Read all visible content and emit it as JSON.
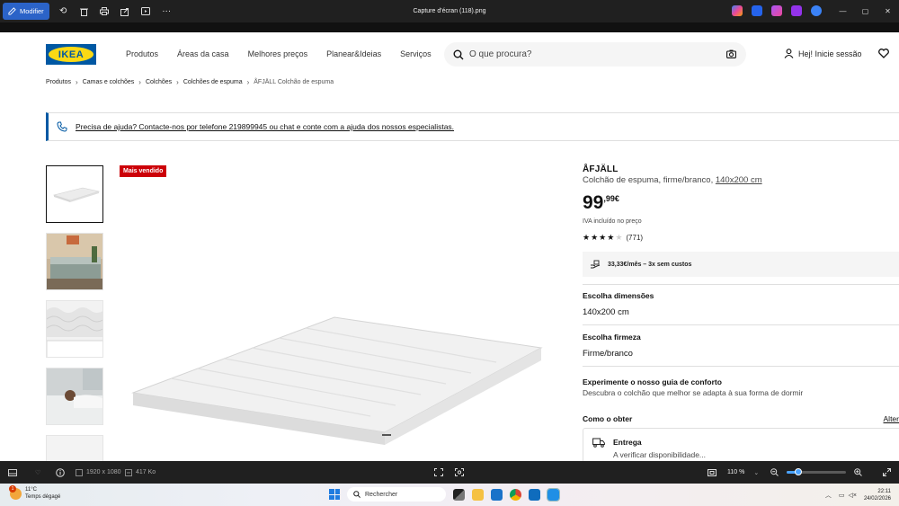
{
  "viewer": {
    "title": "Capture d'écran (118).png",
    "edit_label": "Modifier",
    "image_dims": "1920 x 1080",
    "file_size": "417 Ko",
    "zoom": "110 %",
    "zoom_level_fraction": 0.1
  },
  "ikea": {
    "logo_text": "IKEA",
    "nav": [
      "Produtos",
      "Áreas da casa",
      "Melhores preços",
      "Planear&Ideias",
      "Serviços"
    ],
    "search_placeholder": "O que procura?",
    "login_label": "Hej! Inicie sessão",
    "breadcrumb": [
      "Produtos",
      "Camas e colchões",
      "Colchões",
      "Colchões de espuma",
      "ÅFJÄLL Colchão de espuma"
    ],
    "help_banner": "Precisa de ajuda? Contacte-nos por telefone 219899945 ou chat e conte com a ajuda dos nossos especialistas.",
    "badge": "Mais vendido",
    "product": {
      "name": "ÅFJÄLL",
      "desc_prefix": "Colchão de espuma, firme/branco, ",
      "desc_link": "140x200 cm",
      "price_int": "99",
      "price_dec": ",99€",
      "vat_note": "IVA incluído no preço",
      "rating_value": 4,
      "rating_max": 5,
      "rating_count": "(771)",
      "installment": "33,33€/mês – 3x sem custos",
      "size_label": "Escolha dimensões",
      "size_value": "140x200 cm",
      "firmness_label": "Escolha firmeza",
      "firmness_value": "Firme/branco",
      "guide_title": "Experimente o nosso guia de conforto",
      "guide_sub": "Descubra o colchão que melhor se adapta à sua forma de dormir",
      "howget_label": "Como o obter",
      "howget_link": "Alter",
      "delivery_title": "Entrega",
      "delivery_sub": "A verificar disponibilidade..."
    }
  },
  "taskbar": {
    "temp": "11°C",
    "weather": "Temps dégagé",
    "weather_badge": "1",
    "search_label": "Rechercher",
    "time": "22:11",
    "date": "24/02/2026"
  }
}
